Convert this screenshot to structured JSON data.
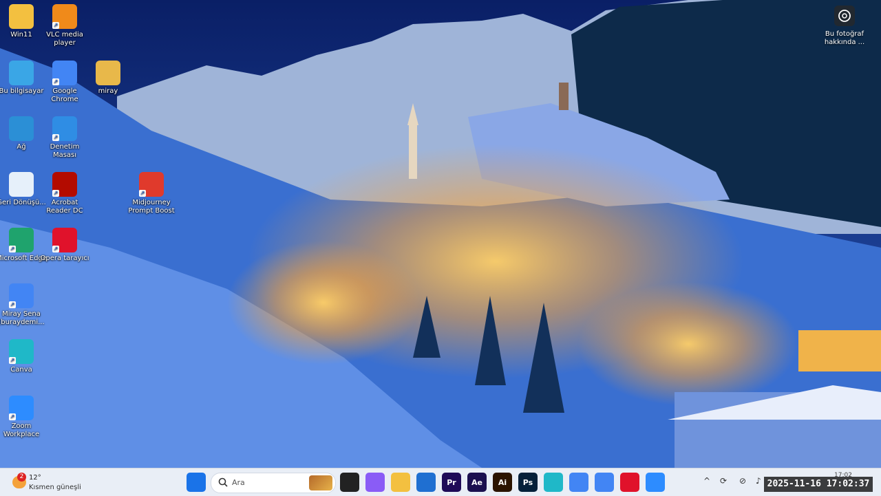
{
  "desktop": {
    "icons": [
      {
        "label": "Win11",
        "icon": "folder-user-icon",
        "color": "#f3c040"
      },
      {
        "label": "VLC media player",
        "icon": "vlc-icon",
        "color": "#f08a1a"
      },
      {
        "label": "Bu bilgisayar",
        "icon": "monitor-icon",
        "color": "#3aa6e6"
      },
      {
        "label": "Google Chrome",
        "icon": "chrome-icon",
        "color": "#4285f4"
      },
      {
        "label": "miray",
        "icon": "folder-icon",
        "color": "#e8b84a"
      },
      {
        "label": "Ağ",
        "icon": "network-icon",
        "color": "#2b8fd6"
      },
      {
        "label": "Denetim Masası",
        "icon": "control-panel-icon",
        "color": "#2f8de4"
      },
      {
        "label": "Geri Dönüşü...",
        "icon": "recycle-bin-icon",
        "color": "#e6f0fa"
      },
      {
        "label": "Acrobat Reader DC",
        "icon": "acrobat-icon",
        "color": "#b30b00"
      },
      {
        "label": "Midjourney Prompt Boost",
        "icon": "pdf-icon",
        "color": "#e03a2c"
      },
      {
        "label": "Microsoft Edge",
        "icon": "edge-icon",
        "color": "#1fa36d"
      },
      {
        "label": "Opera tarayıcı",
        "icon": "opera-icon",
        "color": "#e0122b"
      },
      {
        "label": "Miray Sena (buraydemi...",
        "icon": "chrome-profile-icon",
        "color": "#4285f4"
      },
      {
        "label": "Canva",
        "icon": "canva-icon",
        "color": "#1fb8c8"
      },
      {
        "label": "Zoom Workplace",
        "icon": "zoom-icon",
        "color": "#2d8cff"
      }
    ],
    "photo_info": "Bu fotoğraf hakkında ..."
  },
  "taskbar": {
    "weather": {
      "badge": "2",
      "temp": "12°",
      "condition": "Kısmen güneşli"
    },
    "search": {
      "placeholder": "Ara"
    },
    "apps": [
      {
        "name": "start",
        "text": "",
        "color": "#1a73e8"
      },
      {
        "name": "task-view",
        "text": "",
        "color": "#222222"
      },
      {
        "name": "copilot",
        "text": "",
        "color": "#8a5cf6"
      },
      {
        "name": "file-explorer",
        "text": "",
        "color": "#f3c040"
      },
      {
        "name": "store",
        "text": "",
        "color": "#1f6fd1"
      },
      {
        "name": "premiere",
        "text": "Pr",
        "color": "#1f0a57"
      },
      {
        "name": "after-effects",
        "text": "Ae",
        "color": "#1b0f4f"
      },
      {
        "name": "illustrator",
        "text": "Ai",
        "color": "#2b1300"
      },
      {
        "name": "photoshop",
        "text": "Ps",
        "color": "#05203a"
      },
      {
        "name": "canva",
        "text": "",
        "color": "#1fb8c8"
      },
      {
        "name": "chrome-profile",
        "text": "",
        "color": "#4285f4"
      },
      {
        "name": "chrome",
        "text": "",
        "color": "#4285f4"
      },
      {
        "name": "opera",
        "text": "",
        "color": "#e0122b"
      },
      {
        "name": "zoom",
        "text": "",
        "color": "#2d8cff"
      }
    ],
    "clock_small": "17:02",
    "clock_overlay": "2025-11-16 17:02:37"
  }
}
